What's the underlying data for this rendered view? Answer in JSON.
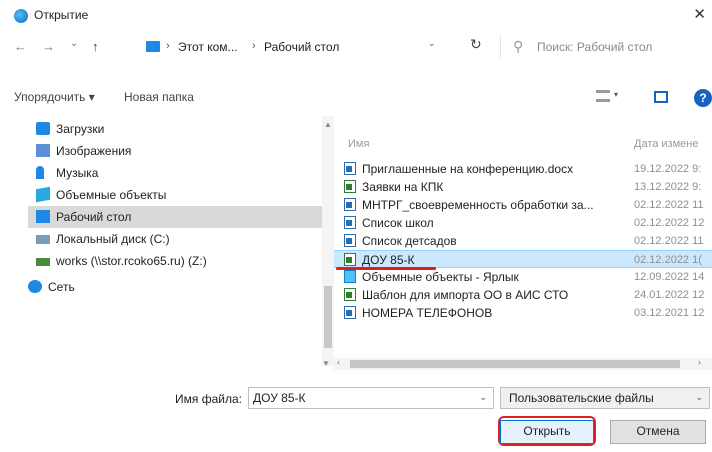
{
  "window": {
    "title": "Открытие",
    "close_glyph": "✕"
  },
  "address": {
    "back_glyph": "←",
    "forward_glyph": "→",
    "recent_glyph": "⌄",
    "up_glyph": "↑",
    "crumbs": [
      "Этот ком...",
      "Рабочий стол"
    ],
    "separator": "›",
    "dropdown_glyph": "⌄",
    "refresh_glyph": "↻",
    "search_placeholder": "Поиск: Рабочий стол",
    "search_glyph": "⚲"
  },
  "toolbar": {
    "organize": "Упорядочить ▾",
    "new_folder": "Новая папка",
    "view_drop": "▾",
    "help": "?"
  },
  "nav": {
    "items": [
      {
        "label": "Загрузки",
        "icon": "download-icon",
        "color": "#1e88e5"
      },
      {
        "label": "Изображения",
        "icon": "pictures-icon",
        "color": "#5c8fd6"
      },
      {
        "label": "Музыка",
        "icon": "music-icon",
        "color": "#1e88e5"
      },
      {
        "label": "Объемные объекты",
        "icon": "3d-objects-icon",
        "color": "#29a8e0"
      },
      {
        "label": "Рабочий стол",
        "icon": "desktop-icon",
        "color": "#1e88e5"
      },
      {
        "label": "Локальный диск (C:)",
        "icon": "drive-icon",
        "color": "#7a9bbd"
      },
      {
        "label": "works (\\\\stor.rcoko65.ru) (Z:)",
        "icon": "network-drive-icon",
        "color": "#4a8a3a"
      },
      {
        "label": "Сеть",
        "icon": "network-icon",
        "color": "#1e88e5"
      }
    ]
  },
  "files": {
    "col_name": "Имя",
    "col_date": "Дата измене",
    "rows": [
      {
        "name": "Приглашенные на конференцию.docx",
        "date": "19.12.2022 9:",
        "type": "doc"
      },
      {
        "name": "Заявки на КПК",
        "date": "13.12.2022 9:",
        "type": "xls"
      },
      {
        "name": "МНТРГ_своевременность обработки за...",
        "date": "02.12.2022 11",
        "type": "doc"
      },
      {
        "name": "Список школ",
        "date": "02.12.2022 12",
        "type": "doc"
      },
      {
        "name": "Список детсадов",
        "date": "02.12.2022 11",
        "type": "doc"
      },
      {
        "name": "ДОУ 85-К",
        "date": "02.12.2022 1(",
        "type": "xls"
      },
      {
        "name": "Объемные объекты - Ярлык",
        "date": "12.09.2022 14",
        "type": "shortcut"
      },
      {
        "name": "Шаблон для импорта ОО в АИС СТО",
        "date": "24.01.2022 12",
        "type": "xls"
      },
      {
        "name": "НОМЕРА ТЕЛЕФОНОВ",
        "date": "03.12.2021 12",
        "type": "doc"
      }
    ],
    "scroll_left": "‹",
    "scroll_right": "›",
    "scroll_up": "▲",
    "scroll_down": "▼"
  },
  "footer": {
    "filename_label": "Имя файла:",
    "filename_value": "ДОУ 85-К",
    "filetype_value": "Пользовательские файлы",
    "dropdown_glyph": "⌄",
    "open_label": "Открыть",
    "cancel_label": "Отмена"
  }
}
